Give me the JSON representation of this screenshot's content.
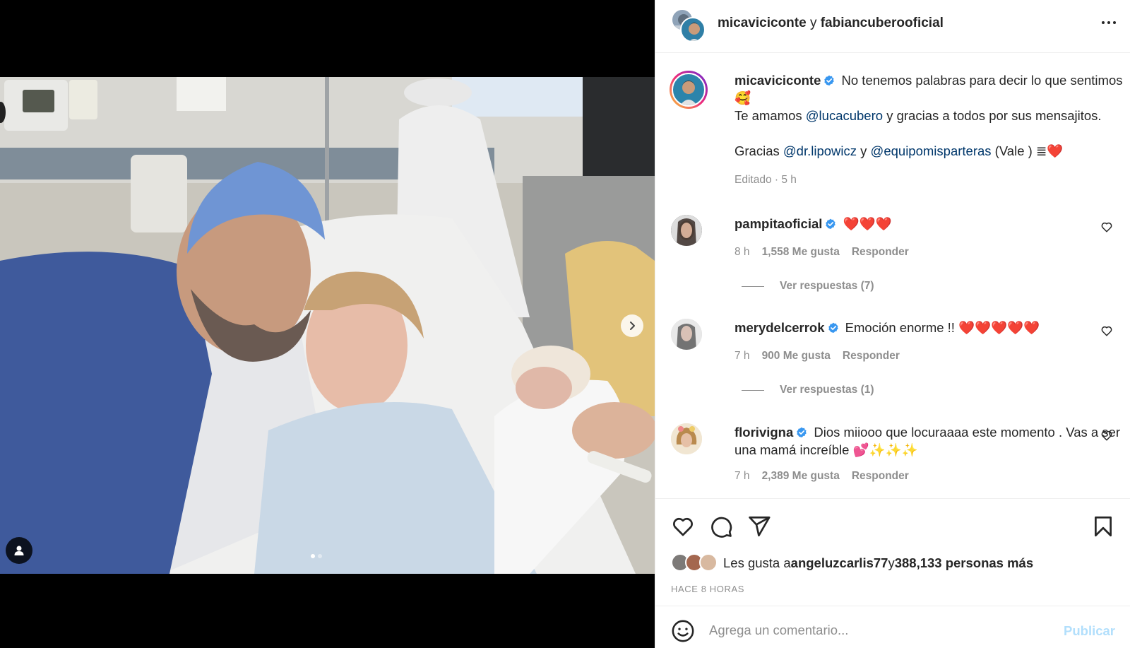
{
  "post": {
    "author": "micaviciconte",
    "connector": "y",
    "coauthor": "fabiancuberooficial",
    "more_icon": "more-horizontal-icon"
  },
  "caption": {
    "username": "micaviciconte",
    "line1": "No tenemos palabras para decir lo que sentimos 🥰",
    "line2_before": "Te amamos ",
    "line2_mention": "@lucacubero",
    "line2_after": " y gracias a todos por sus mensajitos.",
    "line3_before": "Gracias ",
    "line3_mention1": "@dr.lipowicz",
    "line3_mid": " y ",
    "line3_mention2": "@equipomisparteras",
    "line3_after": " (Vale ) ≣❤️",
    "meta": "Editado · 5 h"
  },
  "comments": [
    {
      "username": "pampitaoficial",
      "text": "❤️❤️❤️",
      "time": "8 h",
      "likes": "1,558 Me gusta",
      "reply": "Responder",
      "view_replies": "Ver respuestas (7)"
    },
    {
      "username": "merydelcerrok",
      "text": "Emoción enorme !! ❤️❤️❤️❤️❤️",
      "time": "7 h",
      "likes": "900 Me gusta",
      "reply": "Responder",
      "view_replies": "Ver respuestas (1)"
    },
    {
      "username": "florivigna",
      "text": "Dios miiooo que locuraaaa este momento . Vas a ser una mamá increíble 💕✨✨✨",
      "time": "7 h",
      "likes": "2,389 Me gusta",
      "reply": "Responder"
    }
  ],
  "likes_line": {
    "prefix": "Les gusta a ",
    "user": "angeluzcarlis77",
    "mid": " y ",
    "count": "388,133 personas más"
  },
  "time_ago": "HACE 8 HORAS",
  "composer": {
    "placeholder": "Agrega un comentario...",
    "publish": "Publicar"
  },
  "colors": {
    "link": "#00376b",
    "verified": "#3897f0",
    "muted": "#8e8e8e",
    "publish_disabled": "#b2dffc"
  }
}
